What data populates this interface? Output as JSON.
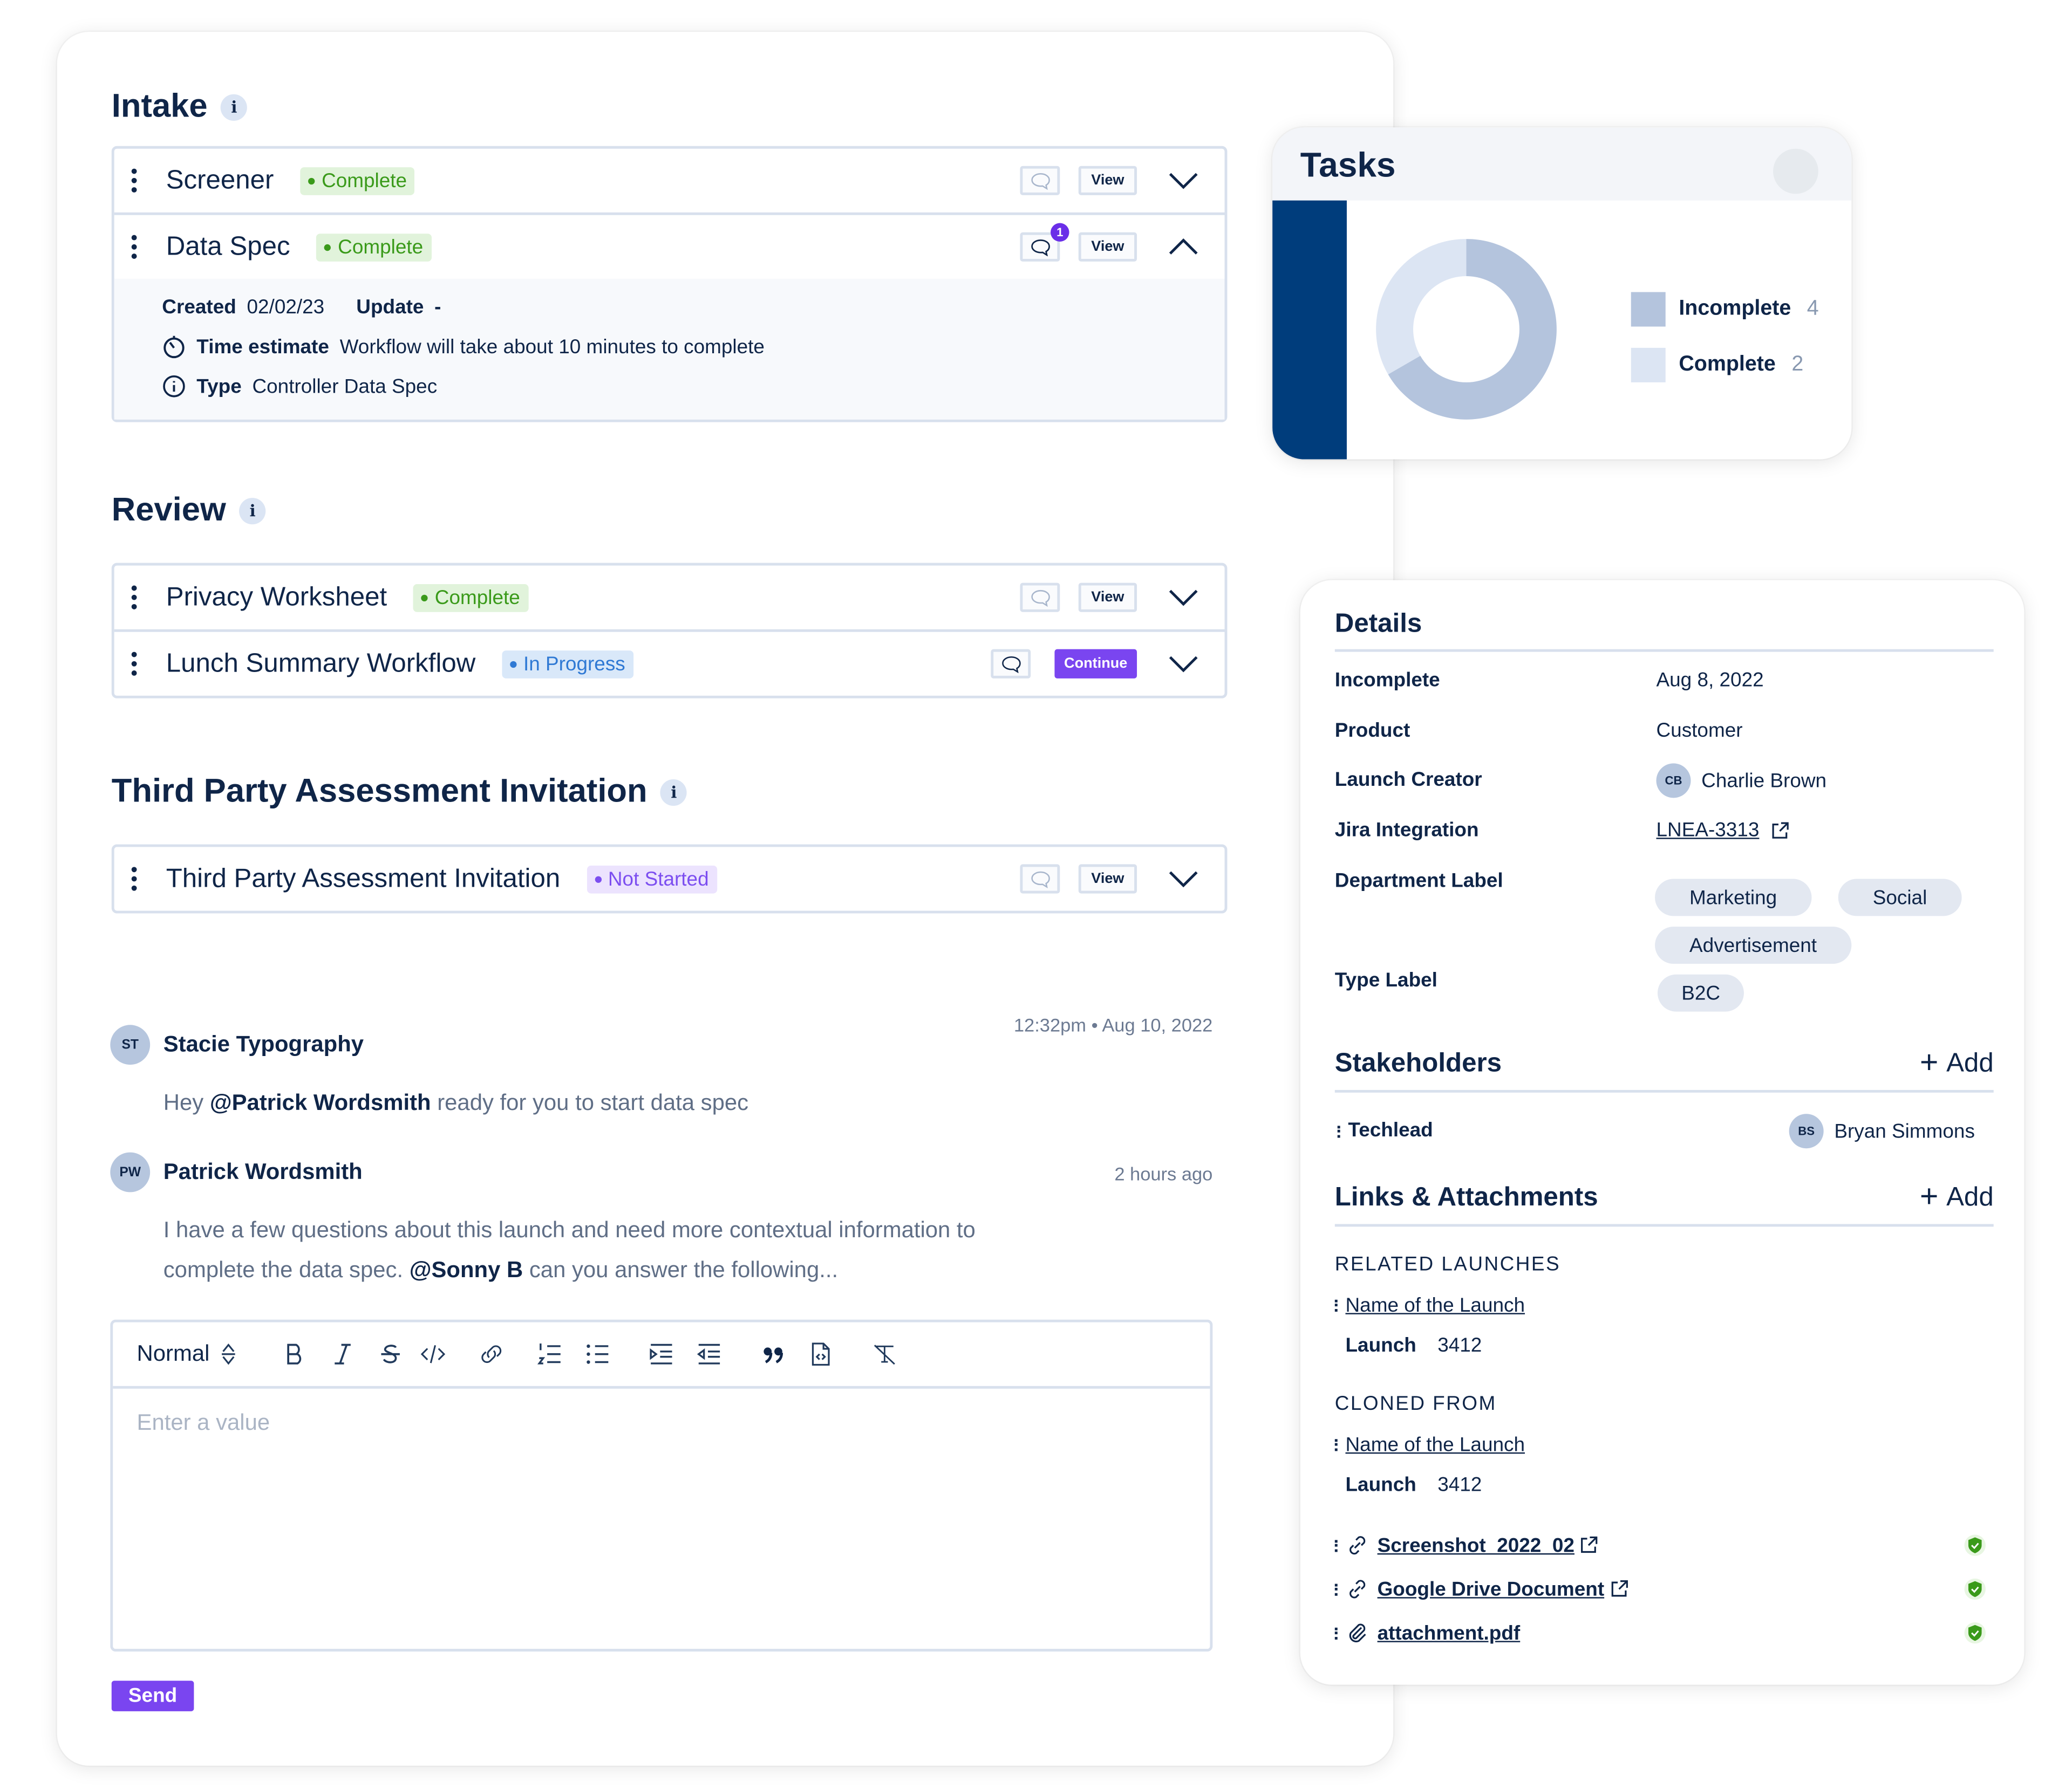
{
  "main": {
    "sections": [
      {
        "title": "Intake",
        "info_icon": "i",
        "items": [
          {
            "title": "Screener",
            "status": "Complete",
            "comment_count": null,
            "action": "View",
            "expanded": false
          },
          {
            "title": "Data Spec",
            "status": "Complete",
            "comment_count": "1",
            "action": "View",
            "expanded": true,
            "details": {
              "created_label": "Created",
              "created_value": "02/02/23",
              "update_label": "Update",
              "update_value": "-",
              "time_label": "Time estimate",
              "time_value": "Workflow will take about 10 minutes to complete",
              "type_label": "Type",
              "type_value": "Controller Data Spec"
            }
          }
        ]
      },
      {
        "title": "Review",
        "info_icon": "i",
        "items": [
          {
            "title": "Privacy Worksheet",
            "status": "Complete",
            "action": "View",
            "expanded": false
          },
          {
            "title": "Lunch Summary Workflow",
            "status": "In Progress",
            "action": "Continue",
            "expanded": false
          }
        ]
      },
      {
        "title": "Third Party Assessment Invitation",
        "info_icon": "i",
        "items": [
          {
            "title": "Third Party Assessment Invitation",
            "status": "Not Started",
            "action": "View",
            "expanded": false
          }
        ]
      }
    ],
    "comments": [
      {
        "initials": "ST",
        "author": "Stacie Typography",
        "time": "12:32pm • Aug 10, 2022",
        "body_pre": "Hey ",
        "mention": "@Patrick Wordsmith",
        "body_post": " ready for you to start data spec"
      },
      {
        "initials": "PW",
        "author": "Patrick Wordsmith",
        "time": "2 hours ago",
        "body_pre": "I have a few questions about this launch and need more contextual information to complete the data spec. ",
        "mention": "@Sonny B",
        "body_post": " can you answer the following..."
      }
    ],
    "editor": {
      "format_select": "Normal",
      "placeholder": "Enter a value",
      "toolbar_icons": [
        "bold-icon",
        "italic-icon",
        "strikethrough-icon",
        "code-icon",
        "link-icon",
        "ordered-list-icon",
        "bullet-list-icon",
        "indent-icon",
        "outdent-icon",
        "blockquote-icon",
        "code-block-icon",
        "clear-format-icon"
      ],
      "send_label": "Send"
    }
  },
  "tasks": {
    "title": "Tasks",
    "accent_color": "#003d7c"
  },
  "chart_data": {
    "type": "pie",
    "variant": "donut",
    "title": "Tasks",
    "categories": [
      "Incomplete",
      "Complete"
    ],
    "values": [
      4,
      2
    ],
    "colors": [
      "#b4c4dd",
      "#dce5f3"
    ],
    "legend_position": "right"
  },
  "details": {
    "title": "Details",
    "fields": [
      {
        "label": "Incomplete",
        "value": "Aug 8, 2022"
      },
      {
        "label": "Product",
        "value": "Customer"
      },
      {
        "label": "Launch Creator",
        "value": "Charlie Brown",
        "initials": "CB"
      },
      {
        "label": "Jira Integration",
        "value": "LNEA-3313"
      },
      {
        "label": "Department Label",
        "chips": [
          "Marketing",
          "Social",
          "Advertisement"
        ]
      },
      {
        "label": "Type Label",
        "chips": [
          "B2C"
        ]
      }
    ],
    "stakeholders": {
      "title": "Stakeholders",
      "add_label": "Add",
      "items": [
        {
          "role": "Techlead",
          "name": "Bryan Simmons",
          "initials": "BS"
        }
      ]
    },
    "links": {
      "title": "Links & Attachments",
      "add_label": "Add",
      "related_heading": "RELATED LAUNCHES",
      "related": {
        "name": "Name of the Launch",
        "launch_label": "Launch",
        "launch_id": "3412"
      },
      "cloned_heading": "CLONED FROM",
      "cloned": {
        "name": "Name of the Launch",
        "launch_label": "Launch",
        "launch_id": "3412"
      },
      "attachments": [
        {
          "name": "Screenshot_2022_02",
          "type": "link",
          "external": true,
          "verified": true
        },
        {
          "name": "Google Drive Document",
          "type": "link",
          "external": true,
          "verified": true
        },
        {
          "name": "attachment.pdf",
          "type": "file",
          "external": false,
          "verified": true
        }
      ]
    }
  }
}
